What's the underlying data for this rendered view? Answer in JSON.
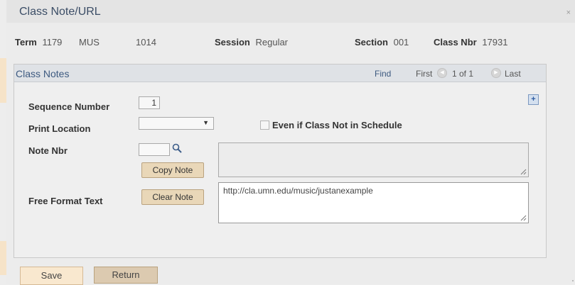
{
  "dialog": {
    "title": "Class Note/URL",
    "close_glyph": "×"
  },
  "info": {
    "term_label": "Term",
    "term_value": "1179",
    "subject": "MUS",
    "catalog": "1014",
    "session_label": "Session",
    "session_value": "Regular",
    "section_label": "Section",
    "section_value": "001",
    "class_nbr_label": "Class Nbr",
    "class_nbr_value": "17931"
  },
  "panel": {
    "title": "Class Notes",
    "find": "Find",
    "first": "First",
    "count": "1 of 1",
    "last": "Last",
    "prev_glyph": "◀",
    "next_glyph": "▶",
    "add_glyph": "+"
  },
  "form": {
    "sequence_label": "Sequence Number",
    "sequence_value": "1",
    "print_location_label": "Print Location",
    "print_location_value": "",
    "select_arrow": "▼",
    "even_if_label": "Even if Class Not in Schedule",
    "note_nbr_label": "Note Nbr",
    "note_nbr_value": "",
    "copy_note": "Copy Note",
    "clear_note": "Clear Note",
    "free_format_label": "Free Format Text",
    "note_text": "",
    "free_format_value": "http://cla.umn.edu/music/justanexample"
  },
  "footer": {
    "save": "Save",
    "return": "Return"
  },
  "colors": {
    "title_text": "#3b4d66",
    "panel_header": "#dfe2e6",
    "button_tan": "#e9d7b8",
    "save_button": "#f9e8cf"
  }
}
